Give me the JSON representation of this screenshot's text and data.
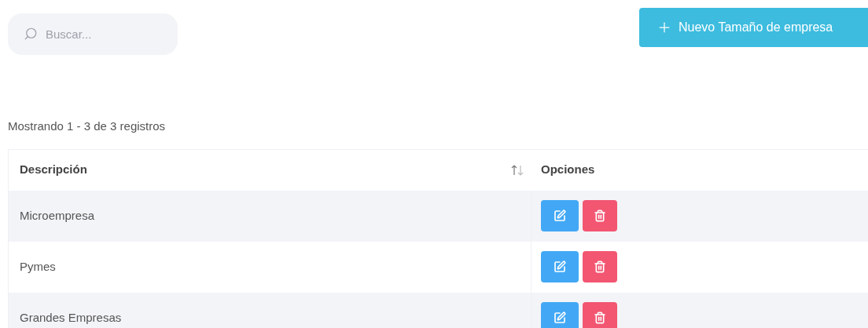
{
  "search": {
    "placeholder": "Buscar..."
  },
  "new_button": {
    "label": "Nuevo Tamaño de empresa"
  },
  "summary": "Mostrando 1 - 3 de 3 registros",
  "table": {
    "columns": [
      "Descripción",
      "Opciones"
    ],
    "rows": [
      {
        "description": "Microempresa"
      },
      {
        "description": "Pymes"
      },
      {
        "description": "Grandes Empresas"
      }
    ]
  }
}
